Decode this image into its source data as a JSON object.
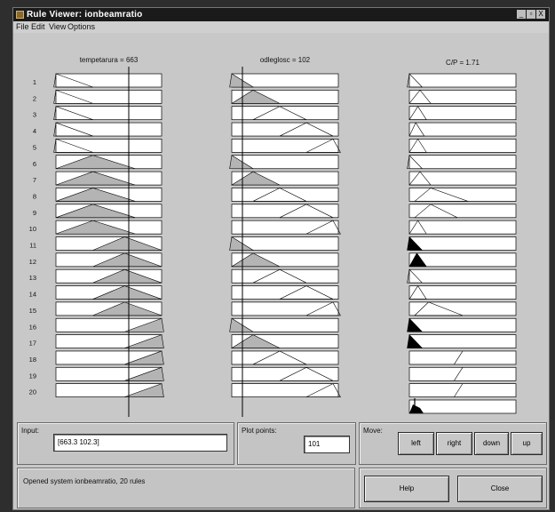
{
  "window": {
    "title": "Rule Viewer: ionbeamratio",
    "controls": [
      "_",
      "▫",
      "X"
    ]
  },
  "menu": {
    "items": [
      "File",
      "Edit",
      "View",
      "Options"
    ]
  },
  "plot": {
    "inputs": [
      {
        "label": "tempetarura = 663",
        "range_min": "450",
        "range_max": "750"
      },
      {
        "label": "odleglosc = 102",
        "range_min": "0",
        "range_max": "900"
      }
    ],
    "output": {
      "label": "C/P = 1.71"
    },
    "rule_numbers": [
      "1",
      "2",
      "3",
      "4",
      "5",
      "6",
      "7",
      "8",
      "9",
      "10",
      "11",
      "12",
      "13",
      "14",
      "15",
      "16",
      "17",
      "18",
      "19",
      "20"
    ]
  },
  "bottom": {
    "input_label": "Input:",
    "input_value": "[663.3 102.3]",
    "plot_points_label": "Plot points:",
    "plot_points_value": "101",
    "move_label": "Move:",
    "move_buttons": [
      "left",
      "right",
      "down",
      "up"
    ],
    "status_text": "Opened system ionbeamratio, 20 rules",
    "help_label": "Help",
    "close_label": "Close"
  },
  "colors": {
    "titlebar": "#1a1a1a",
    "window": "#c8c8c8",
    "membership_fill": "#b4b4b4",
    "index_line": "#000000"
  }
}
